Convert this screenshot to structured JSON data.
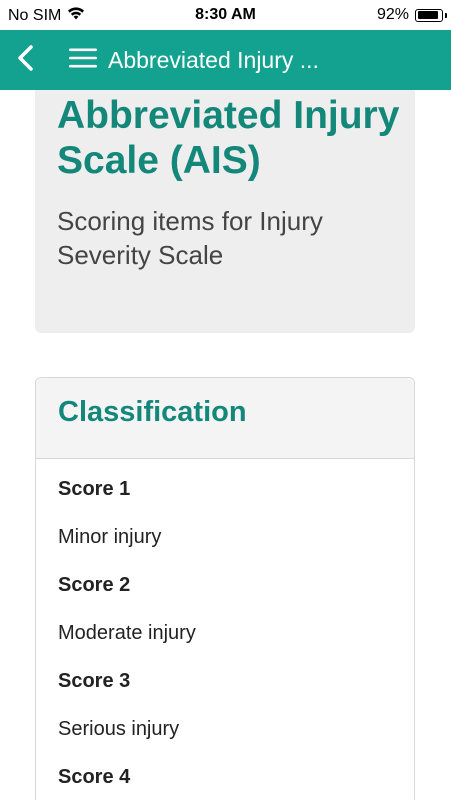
{
  "status_bar": {
    "carrier": "No SIM",
    "time": "8:30 AM",
    "battery_percent_text": "92%",
    "battery_level": 0.92
  },
  "app_bar": {
    "title": "Abbreviated Injury ...",
    "background_color": "#12a28f",
    "back_icon": "chevron-left-icon",
    "menu_icon": "hamburger-menu-icon"
  },
  "hero": {
    "title": "Abbreviated Injury Scale (AIS)",
    "subtitle": "Scoring items for Injury Severity Scale"
  },
  "classification": {
    "title": "Classification",
    "items": [
      {
        "score": "Score 1",
        "description": "Minor injury"
      },
      {
        "score": "Score 2",
        "description": "Moderate injury"
      },
      {
        "score": "Score 3",
        "description": "Serious injury"
      },
      {
        "score": "Score 4",
        "description": ""
      }
    ]
  },
  "colors": {
    "accent": "#13887a",
    "text": "#222222",
    "card_bg": "#eeeeee"
  }
}
